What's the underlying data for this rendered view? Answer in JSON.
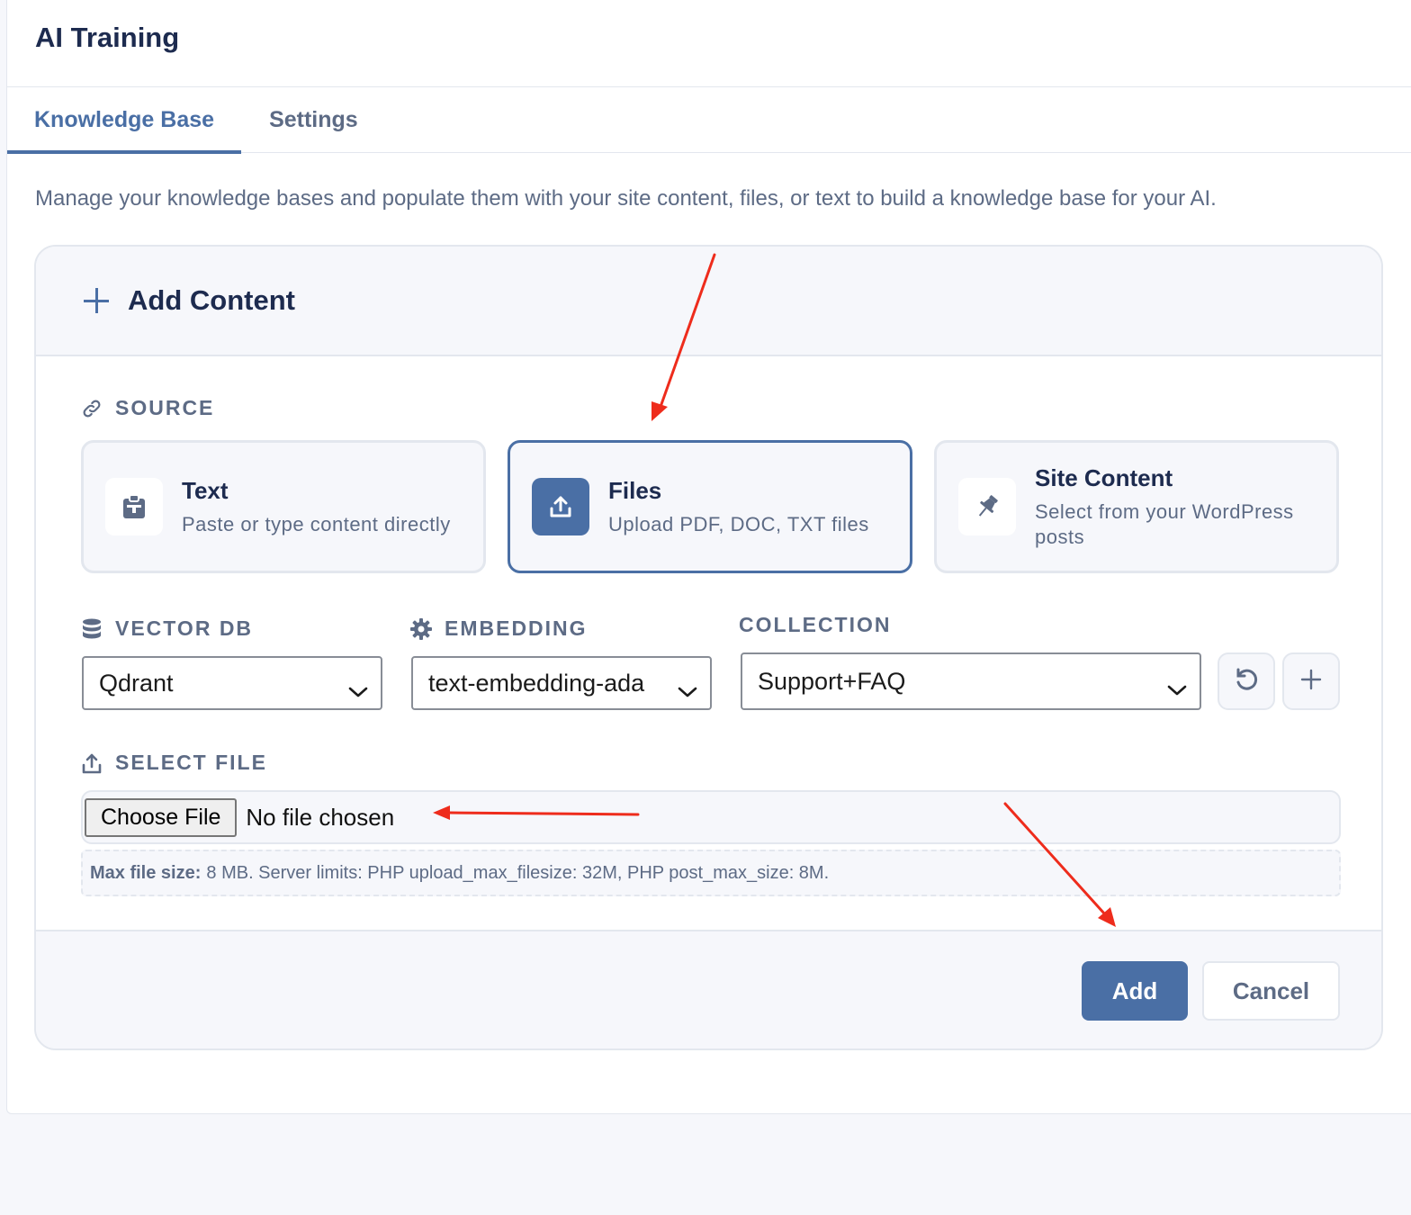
{
  "header": {
    "title": "AI Training"
  },
  "tabs": [
    {
      "label": "Knowledge Base",
      "active": true
    },
    {
      "label": "Settings",
      "active": false
    }
  ],
  "description": "Manage your knowledge bases and populate them with your site content, files, or text to build a knowledge base for your AI.",
  "add_content": {
    "title": "Add Content",
    "source": {
      "label": "SOURCE",
      "options": [
        {
          "title": "Text",
          "subtitle": "Paste or type content directly",
          "icon": "clipboard-icon"
        },
        {
          "title": "Files",
          "subtitle": "Upload PDF, DOC, TXT files",
          "icon": "upload-icon",
          "selected": true
        },
        {
          "title": "Site Content",
          "subtitle": "Select from your WordPress posts",
          "icon": "pin-icon"
        }
      ]
    },
    "vector_db": {
      "label": "VECTOR DB",
      "value": "Qdrant"
    },
    "embedding": {
      "label": "EMBEDDING",
      "value": "text-embedding-ada"
    },
    "collection": {
      "label": "COLLECTION",
      "value": "Support+FAQ"
    },
    "select_file": {
      "label": "SELECT FILE",
      "button": "Choose File",
      "status": "No file chosen",
      "hint_bold": "Max file size:",
      "hint_text": "8 MB. Server limits: PHP upload_max_filesize: 32M, PHP post_max_size: 8M."
    },
    "actions": {
      "add": "Add",
      "cancel": "Cancel"
    }
  },
  "colors": {
    "accent": "#4a6fa5",
    "annotation_arrow": "#ee2c1c",
    "muted_text": "#5d6b85"
  }
}
